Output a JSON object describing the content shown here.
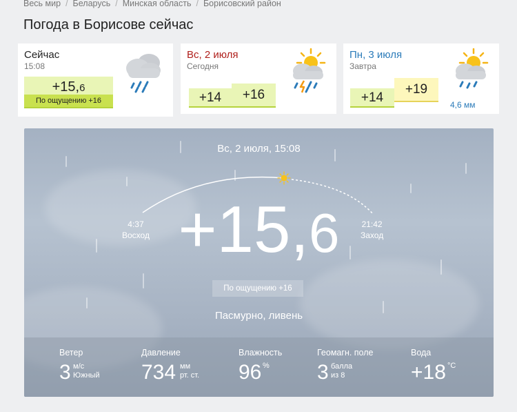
{
  "breadcrumbs": [
    "Весь мир",
    "Беларусь",
    "Минская область",
    "Борисовский район"
  ],
  "page_title": "Погода в Борисове сейчас",
  "now_card": {
    "title": "Сейчас",
    "time": "15:08",
    "temp_int": "+15,",
    "temp_frac": "6",
    "feels": "По ощущению +16",
    "icon": "cloud-rain-icon"
  },
  "today_card": {
    "title": "Вс, 2 июля",
    "sub": "Сегодня",
    "temp_low": "+14",
    "temp_high": "+16",
    "icon": "sun-cloud-thunder-rain-icon"
  },
  "tomorrow_card": {
    "title": "Пн, 3 июля",
    "sub": "Завтра",
    "temp_low": "+14",
    "temp_high": "+19",
    "precip": "4,6 мм",
    "icon": "sun-cloud-rain-icon"
  },
  "hero": {
    "datetime": "Вс, 2 июля, 15:08",
    "sunrise_time": "4:37",
    "sunrise_label": "Восход",
    "sunset_time": "21:42",
    "sunset_label": "Заход",
    "temp_int": "+15,",
    "temp_frac": "6",
    "feels": "По ощущению +16",
    "condition": "Пасмурно, ливень"
  },
  "stats": {
    "wind": {
      "label": "Ветер",
      "value": "3",
      "unit_top": "м/с",
      "unit_bottom": "Южный"
    },
    "pressure": {
      "label": "Давление",
      "value": "734",
      "unit_top": "мм",
      "unit_bottom": "рт. ст."
    },
    "humidity": {
      "label": "Влажность",
      "value": "96",
      "unit_top": "%"
    },
    "geomag": {
      "label": "Геомагн. поле",
      "value": "3",
      "unit_top": "балла",
      "unit_bottom": "из 8"
    },
    "water": {
      "label": "Вода",
      "value": "+18",
      "unit_top": "°C"
    }
  },
  "colors": {
    "today_accent": "#b0201c",
    "tomorrow_accent": "#2b7bb9",
    "temp_green": "#e9f5b6",
    "temp_yellow": "#fdf7bc"
  }
}
